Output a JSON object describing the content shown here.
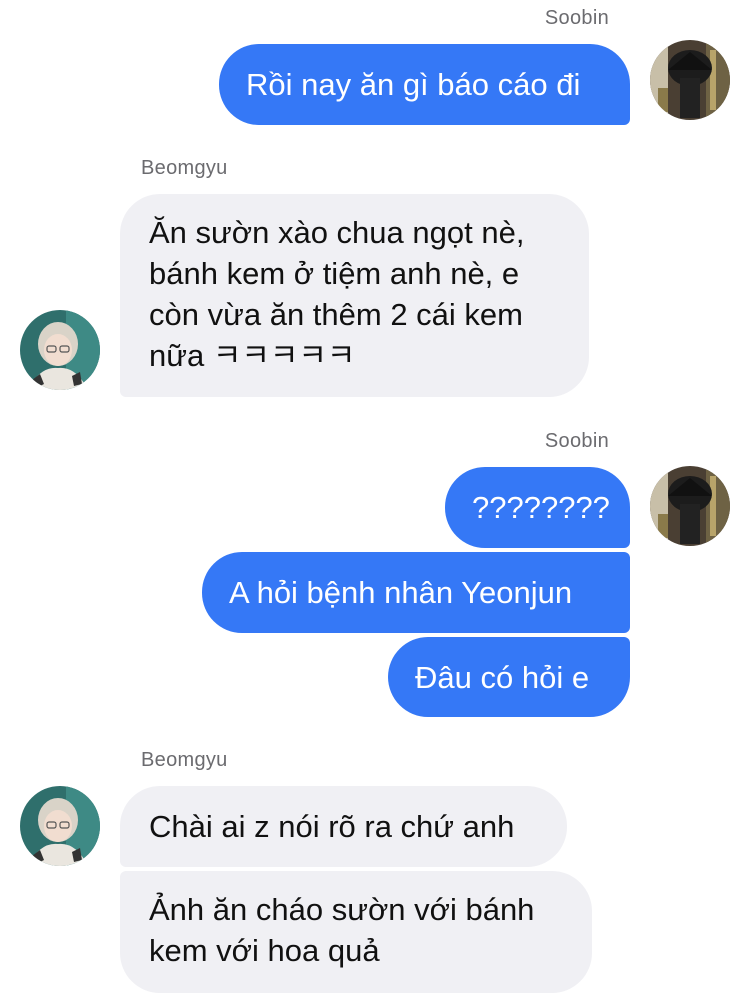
{
  "conversation": {
    "sender_soobin": "Soobin",
    "sender_beomgyu": "Beomgyu",
    "messages": {
      "m1": "Rồi nay ăn gì báo cáo đi",
      "m2": "Ăn sườn xào chua ngọt nè, bánh kem ở tiệm anh nè, e còn vừa ăn thêm 2 cái kem nữa ㅋㅋㅋㅋㅋ",
      "m3": "????????",
      "m4": "A hỏi bệnh nhân Yeonjun",
      "m5": "Đâu có hỏi e",
      "m6": "Chài ai z nói rõ ra chứ anh",
      "m7": "Ảnh ăn cháo sườn với bánh kem với hoa quả"
    }
  },
  "colors": {
    "outgoing_bubble": "#3578f6",
    "incoming_bubble": "#f0f0f4",
    "sender_name": "#6b6b6f"
  },
  "icons": {
    "soobin_avatar": "soobin-avatar",
    "beomgyu_avatar": "beomgyu-avatar"
  }
}
